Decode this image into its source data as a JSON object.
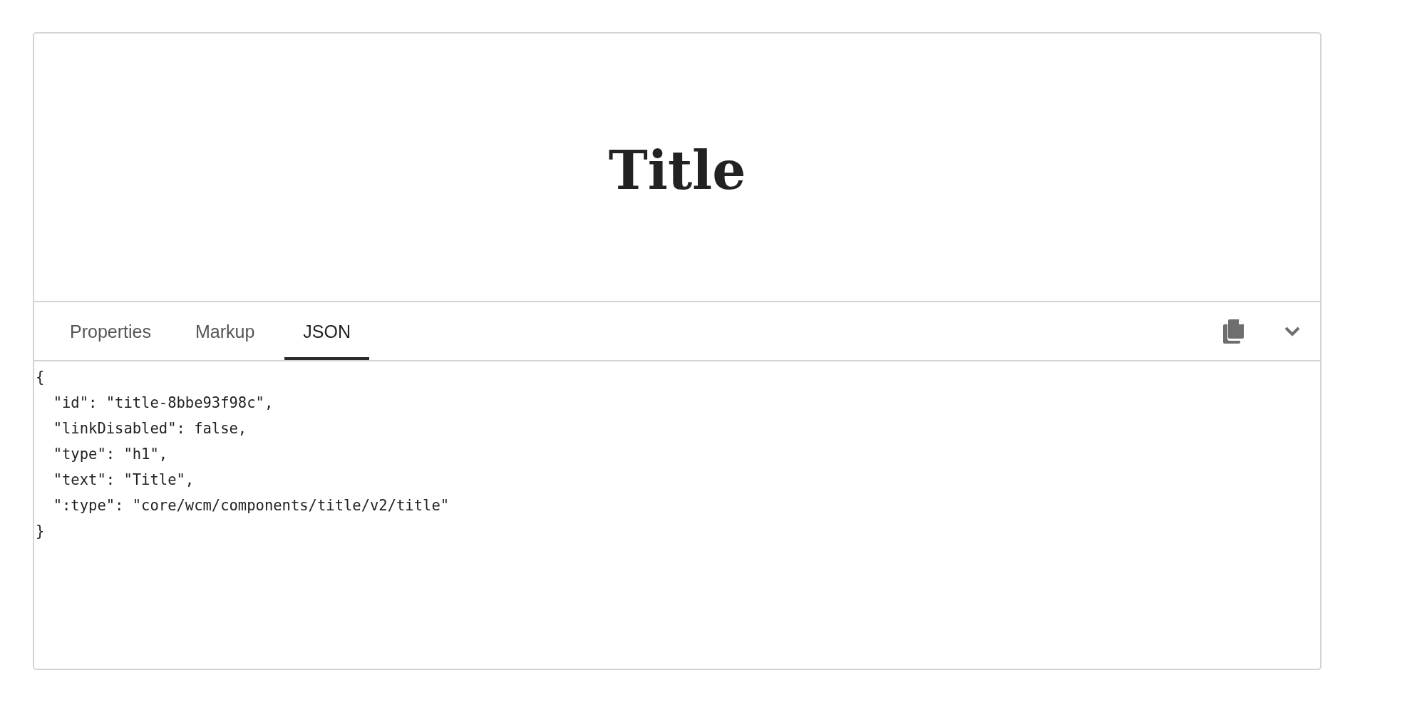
{
  "preview": {
    "heading": "Title"
  },
  "tabs": [
    {
      "label": "Properties",
      "selected": false
    },
    {
      "label": "Markup",
      "selected": false
    },
    {
      "label": "JSON",
      "selected": true
    }
  ],
  "code_lines": [
    "{",
    "  \"id\": \"title-8bbe93f98c\",",
    "  \"linkDisabled\": false,",
    "  \"type\": \"h1\",",
    "  \"text\": \"Title\",",
    "  \":type\": \"core/wcm/components/title/v2/title\"",
    "}"
  ]
}
